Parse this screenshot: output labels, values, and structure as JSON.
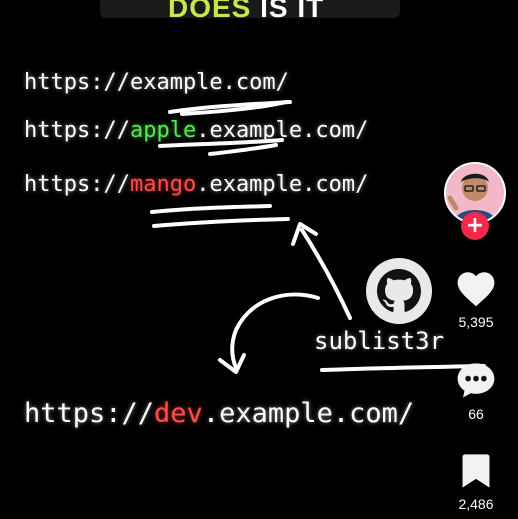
{
  "header": {
    "title_part1": "DOES",
    "title_part2": "IS IT"
  },
  "urls": {
    "line1": {
      "text": "https://example.com/"
    },
    "line2": {
      "prefix": "https://",
      "sub": "apple",
      "suffix": ".example.com/"
    },
    "line3": {
      "prefix": "https://",
      "sub": "mango",
      "suffix": ".example.com/"
    },
    "line4": {
      "prefix": "https://",
      "sub": "dev",
      "suffix": ".example.com/"
    }
  },
  "tool": {
    "label": "sublist3r",
    "icon": "github-octocat-icon"
  },
  "rail": {
    "follow_symbol": "+",
    "likes": "5,395",
    "comments": "66",
    "saves": "2,486"
  },
  "colors": {
    "background": "#000000",
    "green_subdomain": "#58e651",
    "red_subdomain": "#ff4d4d",
    "follow_button": "#f2294a",
    "title_green": "#c6e84d"
  }
}
